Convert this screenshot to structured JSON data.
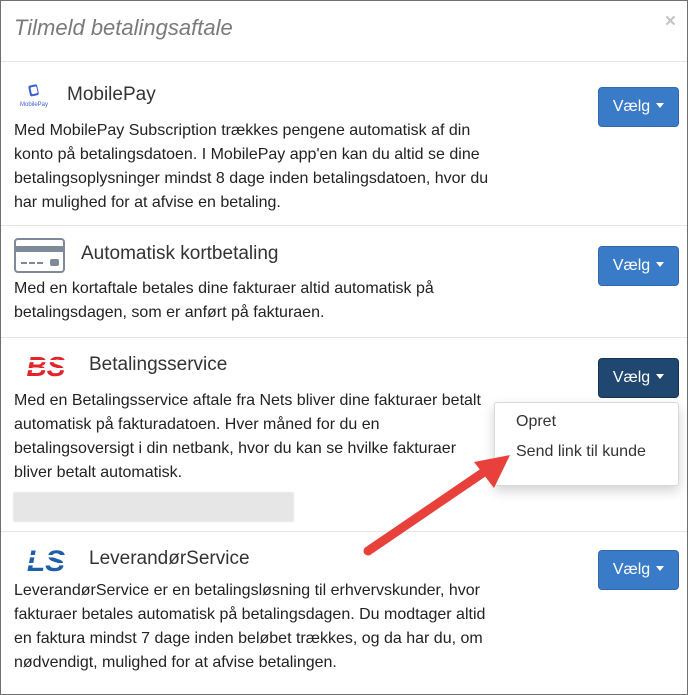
{
  "modal": {
    "title": "Tilmeld betalingsaftale",
    "close_label": "×"
  },
  "providers": [
    {
      "name": "MobilePay",
      "logo_text": "MobilePay",
      "button_label": "Vælg",
      "description_lines": [
        "Med MobilePay Subscription trækkes pengene automatisk af din",
        "konto på betalingsdatoen. I MobilePay app'en kan du altid se dine",
        "betalingsoplysninger mindst 8 dage inden betalingsdatoen, hvor du",
        "har mulighed for at afvise en betaling."
      ]
    },
    {
      "name": "Automatisk kortbetaling",
      "button_label": "Vælg",
      "description_lines": [
        "Med en kortaftale betales dine fakturaer altid automatisk på",
        "betalingsdagen, som er anført på fakturaen."
      ]
    },
    {
      "name": "Betalingsservice",
      "logo_text": "BS",
      "button_label": "Vælg",
      "description_lines": [
        "Med en Betalingsservice aftale fra Nets bliver dine fakturaer betalt",
        "automatisk på fakturadatoen. Hver måned for du en",
        "betalingsoversigt i din netbank, hvor du kan se hvilke fakturaer",
        "bliver betalt automatisk."
      ]
    },
    {
      "name": "LeverandørService",
      "logo_text": "LS",
      "button_label": "Vælg",
      "description_lines": [
        "LeverandørService er en betalingsløsning til erhvervskunder, hvor",
        "fakturaer betales automatisk på betalingsdagen. Du modtager altid",
        "en faktura mindst 7 dage inden beløbet trækkes, og da har du, om",
        "nødvendigt, mulighed for at afvise betalingen."
      ]
    }
  ],
  "dropdown": {
    "items": [
      "Opret",
      "Send link til kunde"
    ]
  },
  "colors": {
    "button": "#3a7bc8",
    "button_active": "#1f4770",
    "bs_red": "#e3242b",
    "ls_blue": "#1f5fa8",
    "arrow": "#e8413c"
  }
}
